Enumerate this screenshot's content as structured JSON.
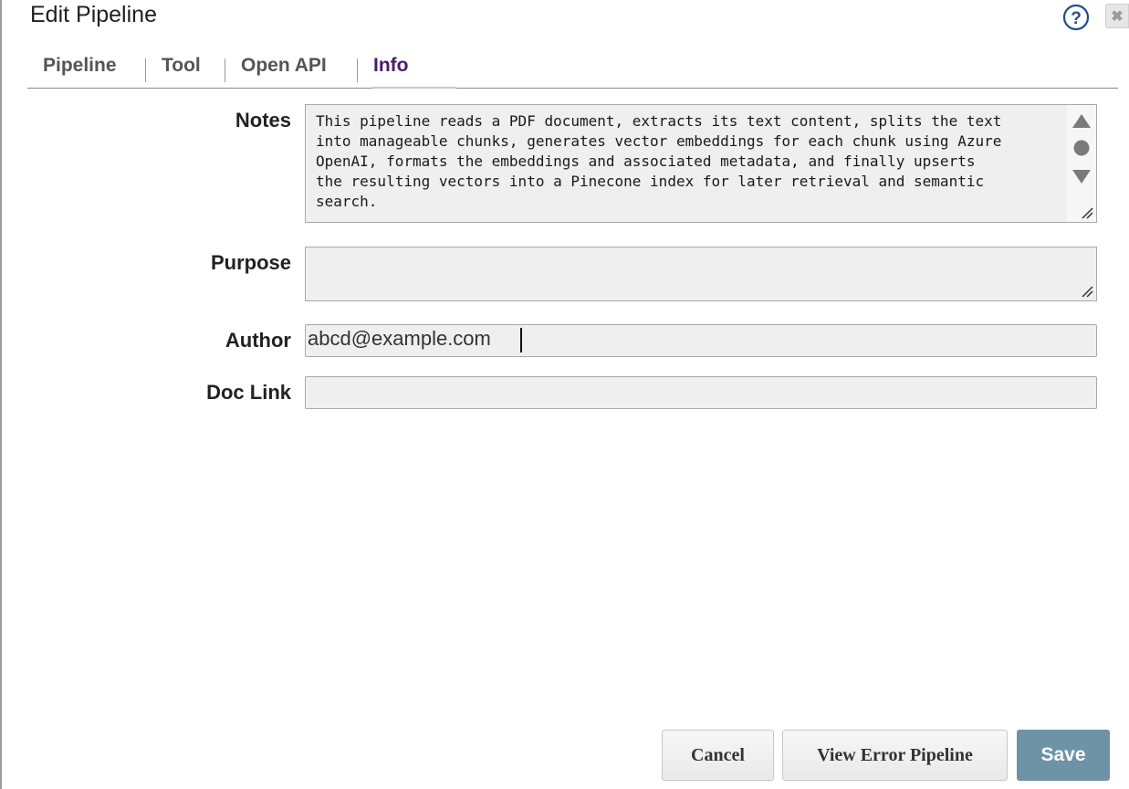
{
  "dialog": {
    "title": "Edit Pipeline",
    "close_label": "✖"
  },
  "tabs": [
    {
      "label": "Pipeline",
      "active": false
    },
    {
      "label": "Tool",
      "active": false
    },
    {
      "label": "Open API",
      "active": false
    },
    {
      "label": "Info",
      "active": true
    }
  ],
  "form": {
    "notes": {
      "label": "Notes",
      "value": "This pipeline reads a PDF document, extracts its text content, splits the text\ninto manageable chunks, generates vector embeddings for each chunk using Azure\nOpenAI, formats the embeddings and associated metadata, and finally upserts\nthe resulting vectors into a Pinecone index for later retrieval and semantic\nsearch."
    },
    "purpose": {
      "label": "Purpose",
      "value": ""
    },
    "author": {
      "label": "Author",
      "value": "abcd@example.com"
    },
    "doc_link": {
      "label": "Doc Link",
      "value": ""
    }
  },
  "buttons": {
    "cancel": "Cancel",
    "view_error_pipeline": "View Error Pipeline",
    "save": "Save"
  },
  "colors": {
    "active_tab": "#4a1a6a",
    "save_button": "#6e93a6",
    "field_bg": "#efefef"
  }
}
